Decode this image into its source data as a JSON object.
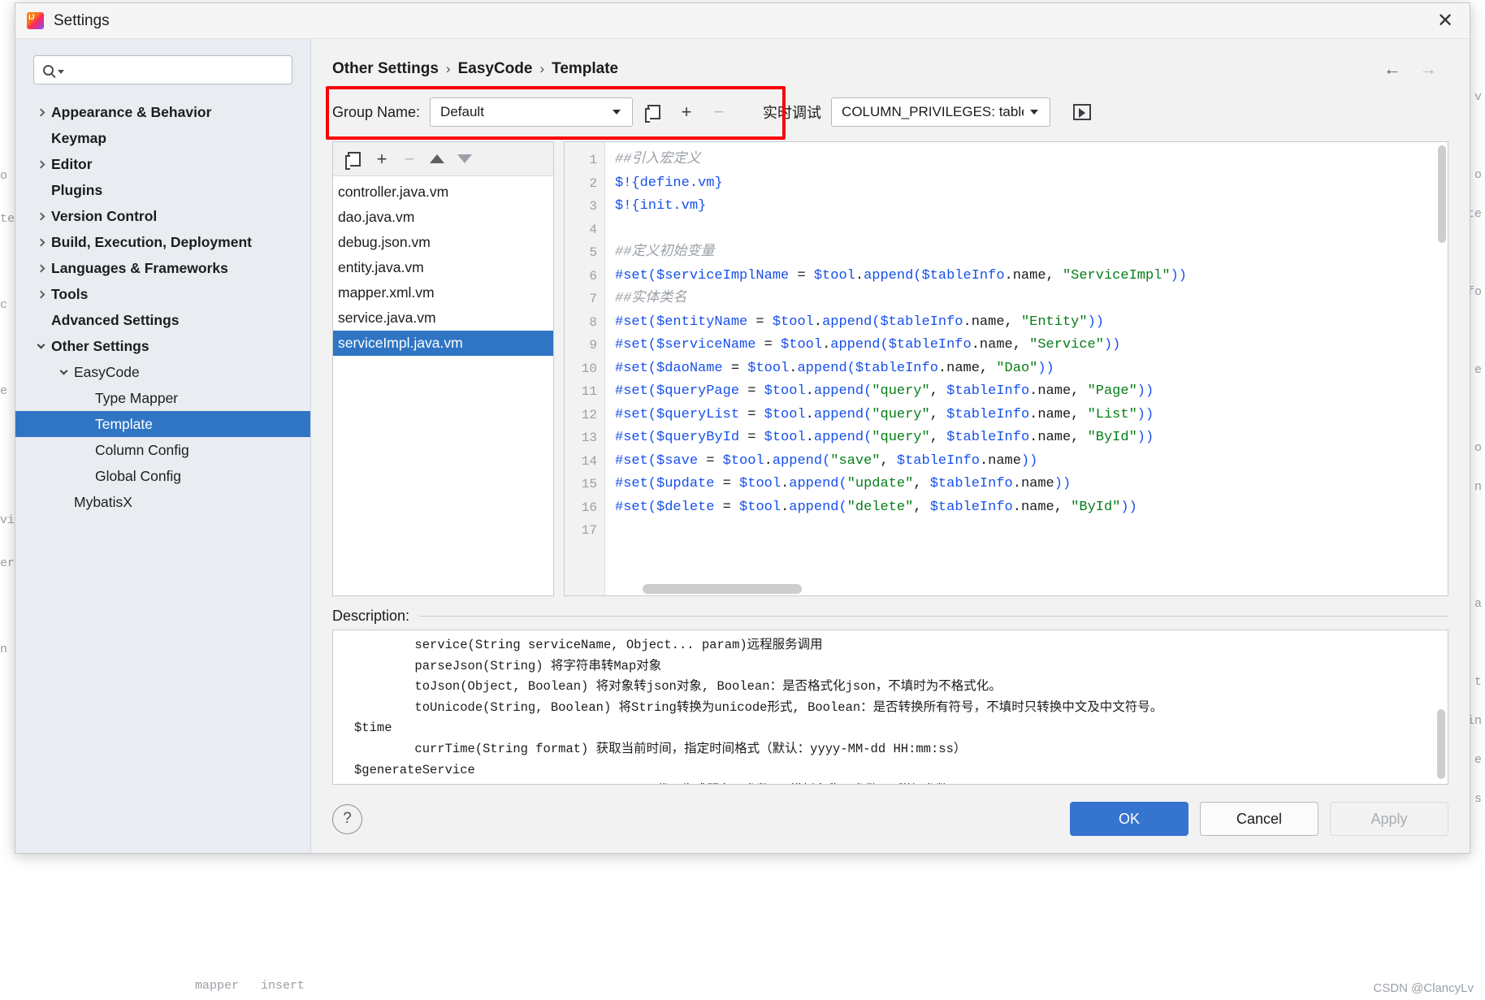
{
  "window": {
    "title": "Settings",
    "app_icon": "intellij-idea-icon",
    "close_icon": "close-icon"
  },
  "search": {
    "placeholder": "",
    "icon": "search-icon"
  },
  "sidebar": {
    "items": [
      {
        "label": "Appearance & Behavior",
        "level": 0,
        "expandable": true,
        "expanded": false,
        "bold": true,
        "selected": false
      },
      {
        "label": "Keymap",
        "level": 0,
        "expandable": false,
        "expanded": false,
        "bold": true,
        "selected": false
      },
      {
        "label": "Editor",
        "level": 0,
        "expandable": true,
        "expanded": false,
        "bold": true,
        "selected": false
      },
      {
        "label": "Plugins",
        "level": 0,
        "expandable": false,
        "expanded": false,
        "bold": true,
        "selected": false
      },
      {
        "label": "Version Control",
        "level": 0,
        "expandable": true,
        "expanded": false,
        "bold": true,
        "selected": false
      },
      {
        "label": "Build, Execution, Deployment",
        "level": 0,
        "expandable": true,
        "expanded": false,
        "bold": true,
        "selected": false
      },
      {
        "label": "Languages & Frameworks",
        "level": 0,
        "expandable": true,
        "expanded": false,
        "bold": true,
        "selected": false
      },
      {
        "label": "Tools",
        "level": 0,
        "expandable": true,
        "expanded": false,
        "bold": true,
        "selected": false
      },
      {
        "label": "Advanced Settings",
        "level": 0,
        "expandable": false,
        "expanded": false,
        "bold": true,
        "selected": false
      },
      {
        "label": "Other Settings",
        "level": 0,
        "expandable": true,
        "expanded": true,
        "bold": true,
        "selected": false
      },
      {
        "label": "EasyCode",
        "level": 1,
        "expandable": true,
        "expanded": true,
        "bold": false,
        "selected": false
      },
      {
        "label": "Type Mapper",
        "level": 2,
        "expandable": false,
        "expanded": false,
        "bold": false,
        "selected": false
      },
      {
        "label": "Template",
        "level": 2,
        "expandable": false,
        "expanded": false,
        "bold": false,
        "selected": true
      },
      {
        "label": "Column Config",
        "level": 2,
        "expandable": false,
        "expanded": false,
        "bold": false,
        "selected": false
      },
      {
        "label": "Global Config",
        "level": 2,
        "expandable": false,
        "expanded": false,
        "bold": false,
        "selected": false
      },
      {
        "label": "MybatisX",
        "level": 1,
        "expandable": false,
        "expanded": false,
        "bold": false,
        "selected": false
      }
    ]
  },
  "breadcrumb": {
    "items": [
      "Other Settings",
      "EasyCode",
      "Template"
    ],
    "separator": "›",
    "back_icon": "arrow-left-icon",
    "forward_icon": "arrow-right-icon"
  },
  "group_bar": {
    "label": "Group Name:",
    "selected_group": "Default",
    "copy_icon": "copy-icon",
    "add_icon": "plus-icon",
    "remove_icon": "minus-icon",
    "highlight_color": "#fb0007"
  },
  "debug_bar": {
    "label": "实时调试",
    "selected_table": "COLUMN_PRIVILEGES: table",
    "run_icon": "run-console-icon"
  },
  "file_list": {
    "toolbar": {
      "copy_icon": "copy-icon",
      "add_icon": "plus-icon",
      "remove_icon": "minus-icon",
      "move_up_icon": "arrow-up-icon",
      "move_down_icon": "arrow-down-icon"
    },
    "items": [
      "controller.java.vm",
      "dao.java.vm",
      "debug.json.vm",
      "entity.java.vm",
      "mapper.xml.vm",
      "service.java.vm",
      "serviceImpl.java.vm"
    ],
    "selected": "serviceImpl.java.vm"
  },
  "editor": {
    "line_numbers": [
      "1",
      "2",
      "3",
      "4",
      "5",
      "6",
      "7",
      "8",
      "9",
      "10",
      "11",
      "12",
      "13",
      "14",
      "15",
      "16",
      "17"
    ],
    "lines": [
      [
        {
          "t": "cmt",
          "s": "##引入宏定义"
        }
      ],
      [
        {
          "t": "kw",
          "s": "$!{define.vm}"
        }
      ],
      [
        {
          "t": "kw",
          "s": "$!{init.vm}"
        }
      ],
      [
        {
          "t": "pln",
          "s": ""
        }
      ],
      [
        {
          "t": "cmt",
          "s": "##定义初始变量"
        }
      ],
      [
        {
          "t": "kw",
          "s": "#set("
        },
        {
          "t": "var",
          "s": "$serviceImplName"
        },
        {
          "t": "pln",
          "s": " = "
        },
        {
          "t": "var",
          "s": "$tool"
        },
        {
          "t": "pln",
          "s": "."
        },
        {
          "t": "var",
          "s": "append"
        },
        {
          "t": "kw",
          "s": "("
        },
        {
          "t": "var",
          "s": "$tableInfo"
        },
        {
          "t": "pln",
          "s": ".name, "
        },
        {
          "t": "str",
          "s": "\"ServiceImpl\""
        },
        {
          "t": "kw",
          "s": "))"
        }
      ],
      [
        {
          "t": "cmt",
          "s": "##实体类名"
        }
      ],
      [
        {
          "t": "kw",
          "s": "#set("
        },
        {
          "t": "var",
          "s": "$entityName"
        },
        {
          "t": "pln",
          "s": " = "
        },
        {
          "t": "var",
          "s": "$tool"
        },
        {
          "t": "pln",
          "s": "."
        },
        {
          "t": "var",
          "s": "append"
        },
        {
          "t": "kw",
          "s": "("
        },
        {
          "t": "var",
          "s": "$tableInfo"
        },
        {
          "t": "pln",
          "s": ".name, "
        },
        {
          "t": "str",
          "s": "\"Entity\""
        },
        {
          "t": "kw",
          "s": "))"
        }
      ],
      [
        {
          "t": "kw",
          "s": "#set("
        },
        {
          "t": "var",
          "s": "$serviceName"
        },
        {
          "t": "pln",
          "s": " = "
        },
        {
          "t": "var",
          "s": "$tool"
        },
        {
          "t": "pln",
          "s": "."
        },
        {
          "t": "var",
          "s": "append"
        },
        {
          "t": "kw",
          "s": "("
        },
        {
          "t": "var",
          "s": "$tableInfo"
        },
        {
          "t": "pln",
          "s": ".name, "
        },
        {
          "t": "str",
          "s": "\"Service\""
        },
        {
          "t": "kw",
          "s": "))"
        }
      ],
      [
        {
          "t": "kw",
          "s": "#set("
        },
        {
          "t": "var",
          "s": "$daoName"
        },
        {
          "t": "pln",
          "s": " = "
        },
        {
          "t": "var",
          "s": "$tool"
        },
        {
          "t": "pln",
          "s": "."
        },
        {
          "t": "var",
          "s": "append"
        },
        {
          "t": "kw",
          "s": "("
        },
        {
          "t": "var",
          "s": "$tableInfo"
        },
        {
          "t": "pln",
          "s": ".name, "
        },
        {
          "t": "str",
          "s": "\"Dao\""
        },
        {
          "t": "kw",
          "s": "))"
        }
      ],
      [
        {
          "t": "kw",
          "s": "#set("
        },
        {
          "t": "var",
          "s": "$queryPage"
        },
        {
          "t": "pln",
          "s": " = "
        },
        {
          "t": "var",
          "s": "$tool"
        },
        {
          "t": "pln",
          "s": "."
        },
        {
          "t": "var",
          "s": "append"
        },
        {
          "t": "kw",
          "s": "("
        },
        {
          "t": "str",
          "s": "\"query\""
        },
        {
          "t": "pln",
          "s": ", "
        },
        {
          "t": "var",
          "s": "$tableInfo"
        },
        {
          "t": "pln",
          "s": ".name, "
        },
        {
          "t": "str",
          "s": "\"Page\""
        },
        {
          "t": "kw",
          "s": "))"
        }
      ],
      [
        {
          "t": "kw",
          "s": "#set("
        },
        {
          "t": "var",
          "s": "$queryList"
        },
        {
          "t": "pln",
          "s": " = "
        },
        {
          "t": "var",
          "s": "$tool"
        },
        {
          "t": "pln",
          "s": "."
        },
        {
          "t": "var",
          "s": "append"
        },
        {
          "t": "kw",
          "s": "("
        },
        {
          "t": "str",
          "s": "\"query\""
        },
        {
          "t": "pln",
          "s": ", "
        },
        {
          "t": "var",
          "s": "$tableInfo"
        },
        {
          "t": "pln",
          "s": ".name, "
        },
        {
          "t": "str",
          "s": "\"List\""
        },
        {
          "t": "kw",
          "s": "))"
        }
      ],
      [
        {
          "t": "kw",
          "s": "#set("
        },
        {
          "t": "var",
          "s": "$queryById"
        },
        {
          "t": "pln",
          "s": " = "
        },
        {
          "t": "var",
          "s": "$tool"
        },
        {
          "t": "pln",
          "s": "."
        },
        {
          "t": "var",
          "s": "append"
        },
        {
          "t": "kw",
          "s": "("
        },
        {
          "t": "str",
          "s": "\"query\""
        },
        {
          "t": "pln",
          "s": ", "
        },
        {
          "t": "var",
          "s": "$tableInfo"
        },
        {
          "t": "pln",
          "s": ".name, "
        },
        {
          "t": "str",
          "s": "\"ById\""
        },
        {
          "t": "kw",
          "s": "))"
        }
      ],
      [
        {
          "t": "kw",
          "s": "#set("
        },
        {
          "t": "var",
          "s": "$save"
        },
        {
          "t": "pln",
          "s": " = "
        },
        {
          "t": "var",
          "s": "$tool"
        },
        {
          "t": "pln",
          "s": "."
        },
        {
          "t": "var",
          "s": "append"
        },
        {
          "t": "kw",
          "s": "("
        },
        {
          "t": "str",
          "s": "\"save\""
        },
        {
          "t": "pln",
          "s": ", "
        },
        {
          "t": "var",
          "s": "$tableInfo"
        },
        {
          "t": "pln",
          "s": ".name"
        },
        {
          "t": "kw",
          "s": "))"
        }
      ],
      [
        {
          "t": "kw",
          "s": "#set("
        },
        {
          "t": "var",
          "s": "$update"
        },
        {
          "t": "pln",
          "s": " = "
        },
        {
          "t": "var",
          "s": "$tool"
        },
        {
          "t": "pln",
          "s": "."
        },
        {
          "t": "var",
          "s": "append"
        },
        {
          "t": "kw",
          "s": "("
        },
        {
          "t": "str",
          "s": "\"update\""
        },
        {
          "t": "pln",
          "s": ", "
        },
        {
          "t": "var",
          "s": "$tableInfo"
        },
        {
          "t": "pln",
          "s": ".name"
        },
        {
          "t": "kw",
          "s": "))"
        }
      ],
      [
        {
          "t": "kw",
          "s": "#set("
        },
        {
          "t": "var",
          "s": "$delete"
        },
        {
          "t": "pln",
          "s": " = "
        },
        {
          "t": "var",
          "s": "$tool"
        },
        {
          "t": "pln",
          "s": "."
        },
        {
          "t": "var",
          "s": "append"
        },
        {
          "t": "kw",
          "s": "("
        },
        {
          "t": "str",
          "s": "\"delete\""
        },
        {
          "t": "pln",
          "s": ", "
        },
        {
          "t": "var",
          "s": "$tableInfo"
        },
        {
          "t": "pln",
          "s": ".name, "
        },
        {
          "t": "str",
          "s": "\"ById\""
        },
        {
          "t": "kw",
          "s": "))"
        }
      ],
      [
        {
          "t": "pln",
          "s": ""
        }
      ]
    ]
  },
  "description": {
    "legend": "Description:",
    "text": "        service(String serviceName, Object... param)远程服务调用\n        parseJson(String) 将字符串转Map对象\n        toJson(Object, Boolean) 将对象转json对象, Boolean：是否格式化json，不填时为不格式化。\n        toUnicode(String, Boolean) 将String转换为unicode形式, Boolean：是否转换所有符号，不填时只转换中文及中文符号。\n$time\n        currTime(String format) 获取当前时间，指定时间格式（默认：yyyy-MM-dd HH:mm:ss）\n$generateService\n        run(String, Map<String,Object>) 代码生成服务，参数1：模板名称，参数2：附加参数。\n$dasUtil Database提供的工具类，具体可方法请查看源码，适用于高端玩家\n        $dasUtil.\n$dbUtil  Database提供的工具类，具体可方法请查看源码，适用于高端玩家"
  },
  "footer": {
    "help_label": "?",
    "ok_label": "OK",
    "cancel_label": "Cancel",
    "apply_label": "Apply"
  },
  "background": {
    "left_text": "o\nte\n\nc\n\ne\n\n\nvi\ner\n\nn",
    "right_text": "v\n\no\nte\n\nfo\n\ne\n\no\nn\n\n\na\n\nt\nin\ne\ns",
    "bottom_text": "mapper   insert",
    "watermark": "CSDN @ClancyLv"
  }
}
